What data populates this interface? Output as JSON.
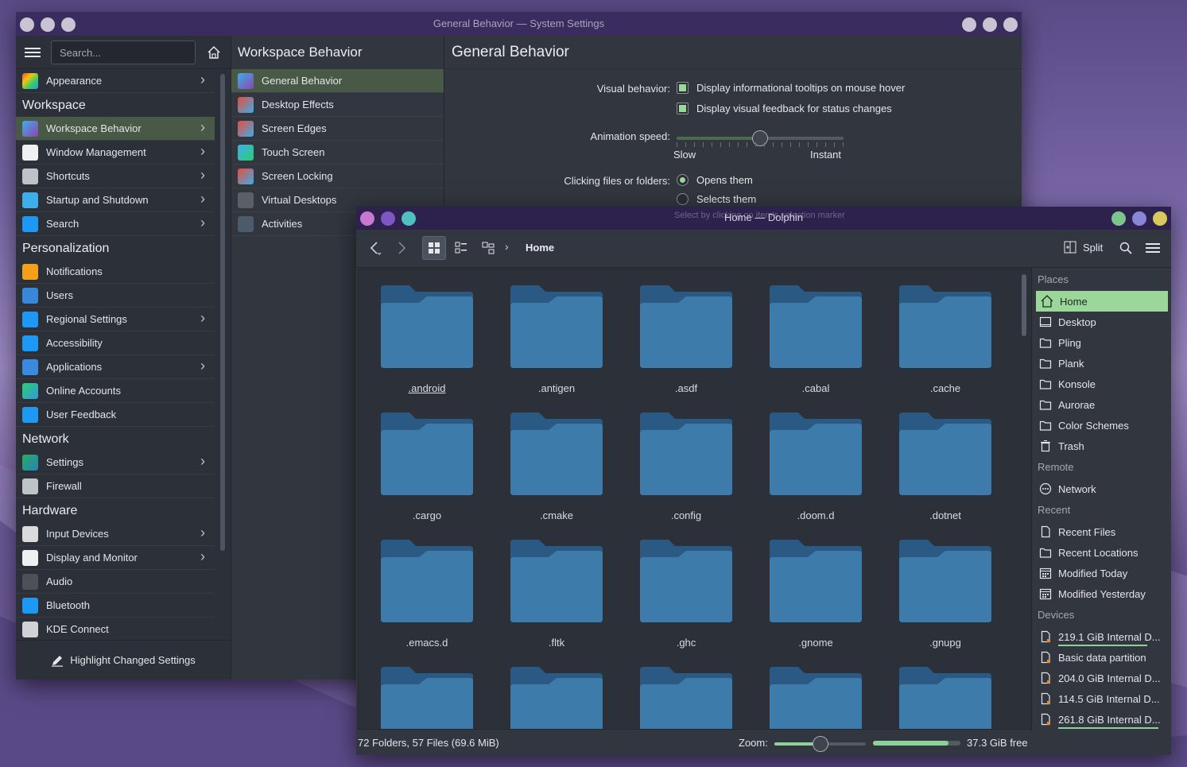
{
  "settings": {
    "window_title": "General Behavior — System Settings",
    "search_placeholder": "Search...",
    "sidebar": {
      "top_item": "Appearance",
      "sections": [
        {
          "title": "Workspace",
          "items": [
            "Workspace Behavior",
            "Window Management",
            "Shortcuts",
            "Startup and Shutdown",
            "Search"
          ]
        },
        {
          "title": "Personalization",
          "items": [
            "Notifications",
            "Users",
            "Regional Settings",
            "Accessibility",
            "Applications",
            "Online Accounts",
            "User Feedback"
          ]
        },
        {
          "title": "Network",
          "items": [
            "Settings",
            "Firewall"
          ]
        },
        {
          "title": "Hardware",
          "items": [
            "Input Devices",
            "Display and Monitor",
            "Audio",
            "Bluetooth",
            "KDE Connect"
          ]
        }
      ],
      "highlight_button": "Highlight Changed Settings"
    },
    "subpanel": {
      "title": "Workspace Behavior",
      "items": [
        "General Behavior",
        "Desktop Effects",
        "Screen Edges",
        "Touch Screen",
        "Screen Locking",
        "Virtual Desktops",
        "Activities"
      ]
    },
    "page": {
      "title": "General Behavior",
      "visual_label": "Visual behavior:",
      "tooltip_option": "Display informational tooltips on mouse hover",
      "feedback_option": "Display visual feedback for status changes",
      "anim_label": "Animation speed:",
      "anim_value": 0.5,
      "slow": "Slow",
      "instant": "Instant",
      "click_label": "Clicking files or folders:",
      "opens": "Opens them",
      "selects": "Selects them",
      "hint": "Select by clicking on item's selection marker"
    }
  },
  "dolphin": {
    "window_title": "Home — Dolphin",
    "breadcrumb": "Home",
    "split_label": "Split",
    "folders": [
      ".android",
      ".antigen",
      ".asdf",
      ".cabal",
      ".cache",
      ".cargo",
      ".cmake",
      ".config",
      ".doom.d",
      ".dotnet",
      ".emacs.d",
      ".fltk",
      ".ghc",
      ".gnome",
      ".gnupg",
      "",
      "",
      "",
      "",
      ""
    ],
    "status": "72 Folders, 57 Files (69.6 MiB)",
    "zoom_label": "Zoom:",
    "zoom_value": 0.5,
    "free": "37.3 GiB free",
    "disk_used_fraction": 0.86,
    "places": {
      "places_title": "Places",
      "places_items": [
        "Home",
        "Desktop",
        "Pling",
        "Plank",
        "Konsole",
        "Aurorae",
        "Color Schemes",
        "Trash"
      ],
      "remote_title": "Remote",
      "remote_items": [
        "Network"
      ],
      "recent_title": "Recent",
      "recent_items": [
        "Recent Files",
        "Recent Locations",
        "Modified Today",
        "Modified Yesterday"
      ],
      "devices_title": "Devices",
      "devices": [
        {
          "label": "219.1 GiB Internal D...",
          "used": 0.8
        },
        {
          "label": "Basic data partition",
          "used": null
        },
        {
          "label": "204.0 GiB Internal D...",
          "used": null
        },
        {
          "label": "114.5 GiB Internal D...",
          "used": null
        },
        {
          "label": "261.8 GiB Internal D...",
          "used": 0.9
        }
      ]
    }
  }
}
